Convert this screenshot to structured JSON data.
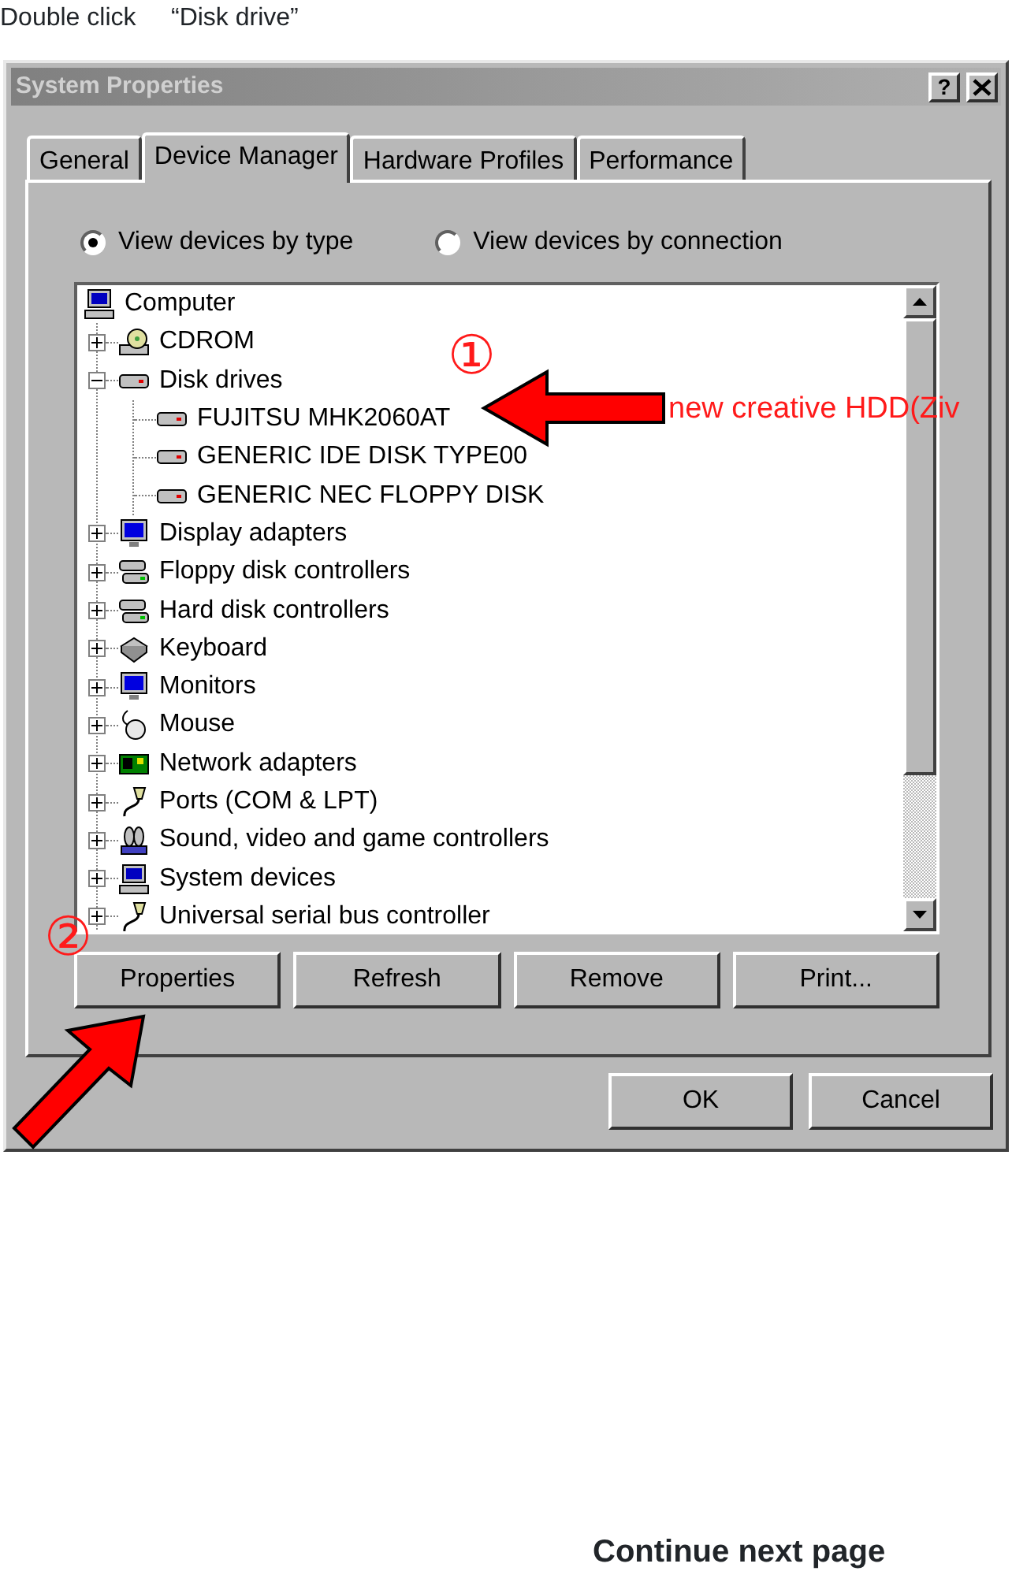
{
  "caption": "Double click     “Disk drive”",
  "window": {
    "title": "System Properties",
    "help_button": "?"
  },
  "tabs": [
    {
      "label": "General",
      "selected": false
    },
    {
      "label": "Device Manager",
      "selected": true
    },
    {
      "label": "Hardware Profiles",
      "selected": false
    },
    {
      "label": "Performance",
      "selected": false
    }
  ],
  "view_options": [
    {
      "label": "View devices by type",
      "selected": true
    },
    {
      "label": "View devices by connection",
      "selected": false
    }
  ],
  "device_tree": {
    "items": [
      {
        "label": "Computer",
        "kind": "computer",
        "children": [
          {
            "label": "CDROM",
            "kind": "cdrom",
            "expanded": false
          },
          {
            "label": "Disk drives",
            "kind": "disk",
            "expanded": true,
            "children": [
              {
                "label": "FUJITSU MHK2060AT",
                "kind": "disk"
              },
              {
                "label": "GENERIC IDE  DISK TYPE00",
                "kind": "disk"
              },
              {
                "label": "GENERIC NEC  FLOPPY DISK",
                "kind": "disk"
              }
            ]
          },
          {
            "label": "Display adapters",
            "kind": "monitor",
            "expanded": false
          },
          {
            "label": "Floppy disk controllers",
            "kind": "controller",
            "expanded": false
          },
          {
            "label": "Hard disk controllers",
            "kind": "controller",
            "expanded": false
          },
          {
            "label": "Keyboard",
            "kind": "keyboard",
            "expanded": false
          },
          {
            "label": "Monitors",
            "kind": "monitor",
            "expanded": false
          },
          {
            "label": "Mouse",
            "kind": "mouse",
            "expanded": false
          },
          {
            "label": "Network adapters",
            "kind": "network",
            "expanded": false
          },
          {
            "label": "Ports (COM & LPT)",
            "kind": "port",
            "expanded": false
          },
          {
            "label": "Sound, video and game controllers",
            "kind": "sound",
            "expanded": false
          },
          {
            "label": "System devices",
            "kind": "computer",
            "expanded": false
          },
          {
            "label": "Universal serial bus controller",
            "kind": "port",
            "expanded": false
          }
        ]
      }
    ]
  },
  "action_buttons": [
    "Properties",
    "Refresh",
    "Remove",
    "Print..."
  ],
  "dialog_buttons": [
    "OK",
    "Cancel"
  ],
  "annotations": [
    {
      "number": "①",
      "note": "new creative HDD(Ziv"
    },
    {
      "number": "②"
    }
  ],
  "footer": "Continue next page"
}
